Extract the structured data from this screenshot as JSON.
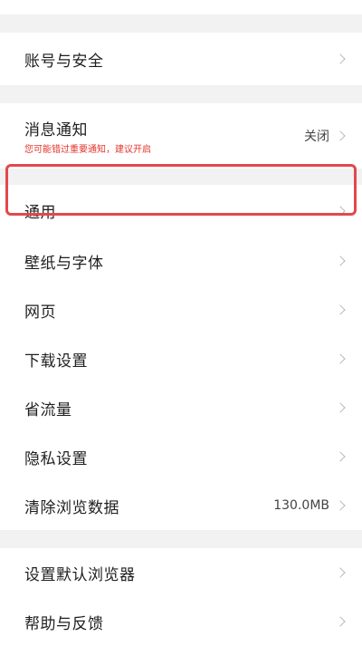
{
  "rows": {
    "account_security": "账号与安全",
    "notification": "消息通知",
    "notification_sub": "您可能错过重要通知，建议开启",
    "notification_value": "关闭",
    "general": "通用",
    "wallpaper_font": "壁纸与字体",
    "webpage": "网页",
    "download_settings": "下载设置",
    "save_data": "省流量",
    "privacy_settings": "隐私设置",
    "clear_data": "清除浏览数据",
    "clear_data_value": "130.0MB",
    "default_browser": "设置默认浏览器",
    "help_feedback": "帮助与反馈"
  },
  "colors": {
    "highlight": "#e2484d",
    "warning_text": "#e0352b",
    "background": "#f2f2f2",
    "card": "#ffffff"
  },
  "icons": {
    "chevron": "chevron-right-icon"
  }
}
